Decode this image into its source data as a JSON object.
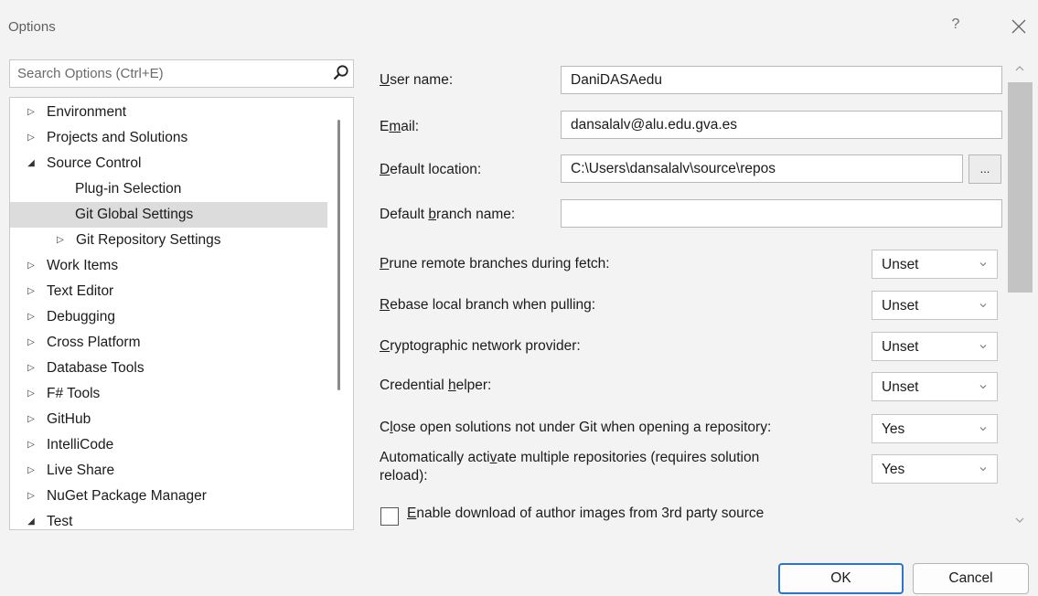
{
  "window": {
    "title": "Options",
    "help": "?"
  },
  "search": {
    "placeholder": "Search Options (Ctrl+E)"
  },
  "tree": {
    "items": [
      {
        "label": "Environment",
        "arrow": "▷",
        "level": 0
      },
      {
        "label": "Projects and Solutions",
        "arrow": "▷",
        "level": 0
      },
      {
        "label": "Source Control",
        "arrow": "◢",
        "level": 0
      },
      {
        "label": "Plug-in Selection",
        "arrow": "",
        "level": 1
      },
      {
        "label": "Git Global Settings",
        "arrow": "",
        "level": 1,
        "selected": true
      },
      {
        "label": "Git Repository Settings",
        "arrow": "▷",
        "level": 1
      },
      {
        "label": "Work Items",
        "arrow": "▷",
        "level": 0
      },
      {
        "label": "Text Editor",
        "arrow": "▷",
        "level": 0
      },
      {
        "label": "Debugging",
        "arrow": "▷",
        "level": 0
      },
      {
        "label": "Cross Platform",
        "arrow": "▷",
        "level": 0
      },
      {
        "label": "Database Tools",
        "arrow": "▷",
        "level": 0
      },
      {
        "label": "F# Tools",
        "arrow": "▷",
        "level": 0
      },
      {
        "label": "GitHub",
        "arrow": "▷",
        "level": 0
      },
      {
        "label": "IntelliCode",
        "arrow": "▷",
        "level": 0
      },
      {
        "label": "Live Share",
        "arrow": "▷",
        "level": 0
      },
      {
        "label": "NuGet Package Manager",
        "arrow": "▷",
        "level": 0
      },
      {
        "label": "Test",
        "arrow": "◢",
        "level": 0
      }
    ]
  },
  "form": {
    "user_name": {
      "pre": "",
      "u": "U",
      "post": "ser name:",
      "value": "DaniDASAedu"
    },
    "email": {
      "pre": "E",
      "u": "m",
      "post": "ail:",
      "value": "dansalalv@alu.edu.gva.es"
    },
    "default_location": {
      "pre": "",
      "u": "D",
      "post": "efault location:",
      "value": "C:\\Users\\dansalalv\\source\\repos",
      "browse": "..."
    },
    "default_branch": {
      "pre": "Default ",
      "u": "b",
      "post": "ranch name:",
      "value": ""
    }
  },
  "options": [
    {
      "pre": "",
      "u": "P",
      "post": "rune remote branches during fetch:",
      "value": "Unset"
    },
    {
      "pre": "",
      "u": "R",
      "post": "ebase local branch when pulling:",
      "value": "Unset"
    },
    {
      "pre": "",
      "u": "C",
      "post": "ryptographic network provider:",
      "value": "Unset"
    },
    {
      "pre": "Credential ",
      "u": "h",
      "post": "elper:",
      "value": "Unset"
    },
    {
      "pre": "C",
      "u": "l",
      "post": "ose open solutions not under Git when opening a repository:",
      "value": "Yes"
    },
    {
      "pre": "Automatically acti",
      "u": "v",
      "post": "ate multiple repositories (requires solution",
      "line2": "reload):",
      "value": "Yes"
    }
  ],
  "checkbox": {
    "pre": "",
    "u": "E",
    "post": "nable download of author images from 3rd party source",
    "checked": false
  },
  "buttons": {
    "ok": "OK",
    "cancel": "Cancel"
  }
}
